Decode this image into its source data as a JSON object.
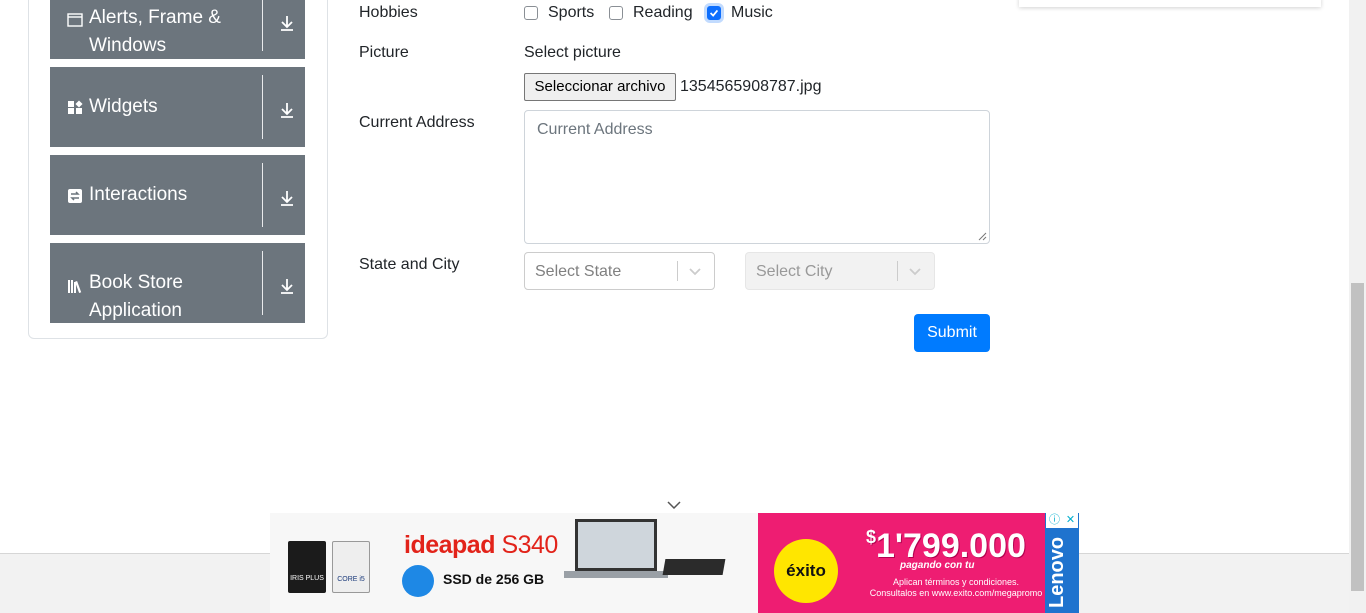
{
  "sidebar": {
    "groups": [
      {
        "label_line1": "Alerts, Frame &",
        "label_line2": "Windows",
        "icon": "window-icon"
      },
      {
        "label_line1": "Widgets",
        "icon": "widgets-icon"
      },
      {
        "label_line1": "Interactions",
        "icon": "interactions-icon"
      },
      {
        "label_line1": "Book Store",
        "label_line2": "Application",
        "icon": "books-icon"
      }
    ]
  },
  "form": {
    "hobbies_label": "Hobbies",
    "hobbies": [
      {
        "label": "Sports",
        "checked": false
      },
      {
        "label": "Reading",
        "checked": false
      },
      {
        "label": "Music",
        "checked": true
      }
    ],
    "picture_label": "Picture",
    "picture_hint": "Select picture",
    "file_button": "Seleccionar archivo",
    "file_name": "1354565908787.jpg",
    "address_label": "Current Address",
    "address_placeholder": "Current Address",
    "state_city_label": "State and City",
    "state_placeholder": "Select State",
    "city_placeholder": "Select City",
    "submit_label": "Submit"
  },
  "ad": {
    "brand": "ideapad",
    "model": "S340",
    "ssd_text": "SSD de 256 GB",
    "badge1": "IRIS PLUS",
    "badge2": "CORE i5",
    "store": "éxito",
    "price_symbol": "$",
    "price": "1'799.000",
    "pagando": "pagando con tu",
    "terms_line1": "Aplican términos y condiciones.",
    "terms_line2": "Consultalos en www.exito.com/megapromo",
    "sponsor": "Lenovo",
    "ad_info": "ⓘ",
    "ad_close": "✕"
  },
  "colors": {
    "sidebar_bg": "#6c757d",
    "accent": "#007bff",
    "checkbox_checked": "#0d6efd",
    "ad_pink": "#ee1d72"
  }
}
